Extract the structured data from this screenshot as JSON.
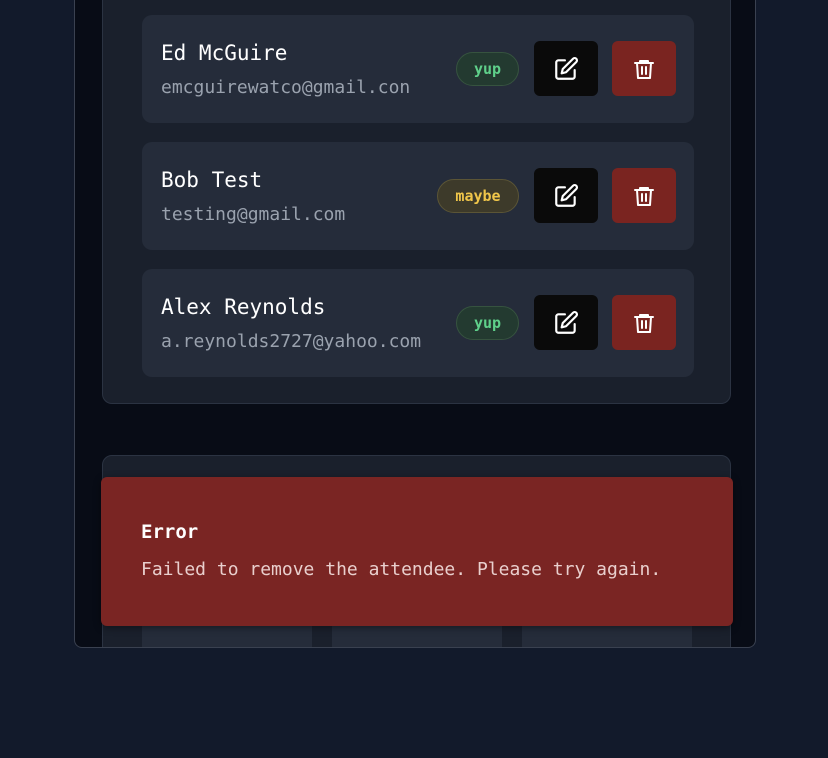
{
  "attendees": [
    {
      "name": "Ed McGuire",
      "email": "emcguirewatco@gmail.con",
      "status": "yup"
    },
    {
      "name": "Bob Test",
      "email": "testing@gmail.com",
      "status": "maybe"
    },
    {
      "name": "Alex Reynolds",
      "email": "a.reynolds2727@yahoo.com",
      "status": "yup"
    }
  ],
  "icons": {
    "edit": "edit-icon",
    "delete": "trash-icon"
  },
  "error": {
    "title": "Error",
    "message": "Failed to remove the attendee. Please try again."
  },
  "colors": {
    "background": "#121a2b",
    "card": "#1a202c",
    "row": "#252c3a",
    "delete_button": "#7a2420",
    "error_toast": "#7a2523",
    "yup": "#5fd08a",
    "maybe": "#f0c64a"
  }
}
